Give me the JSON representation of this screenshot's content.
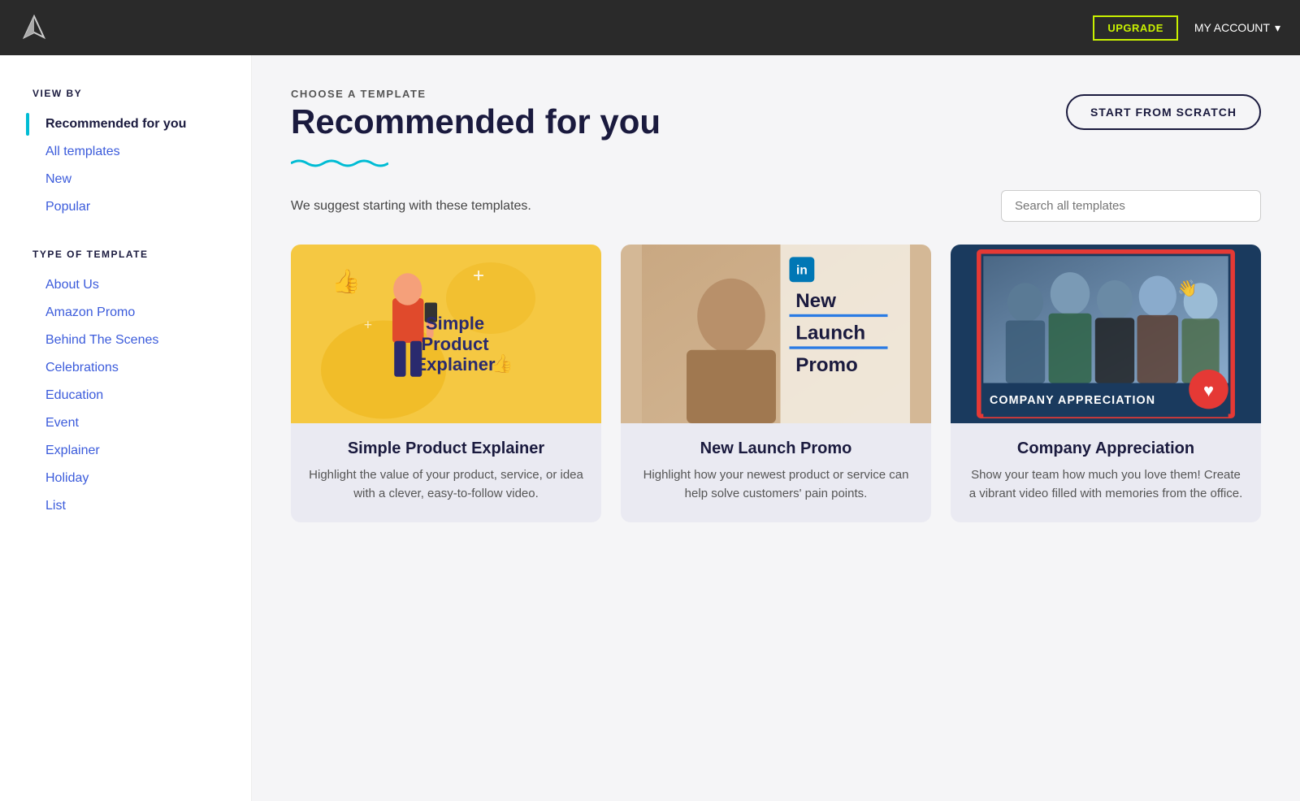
{
  "topnav": {
    "upgrade_label": "UPGRADE",
    "my_account_label": "MY ACCOUNT"
  },
  "sidebar": {
    "view_by_title": "VIEW BY",
    "view_by_items": [
      {
        "label": "Recommended for you",
        "active": true
      },
      {
        "label": "All templates",
        "active": false
      },
      {
        "label": "New",
        "active": false
      },
      {
        "label": "Popular",
        "active": false
      }
    ],
    "type_title": "TYPE OF TEMPLATE",
    "type_items": [
      {
        "label": "About Us"
      },
      {
        "label": "Amazon Promo"
      },
      {
        "label": "Behind The Scenes"
      },
      {
        "label": "Celebrations"
      },
      {
        "label": "Education"
      },
      {
        "label": "Event"
      },
      {
        "label": "Explainer"
      },
      {
        "label": "Holiday"
      },
      {
        "label": "List"
      }
    ]
  },
  "content": {
    "choose_label": "CHOOSE A TEMPLATE",
    "page_title": "Recommended for you",
    "start_scratch_label": "START FROM SCRATCH",
    "subtitle": "We suggest starting with these templates.",
    "search_placeholder": "Search all templates",
    "cards": [
      {
        "title": "Simple Product Explainer",
        "description": "Highlight the value of your product, service, or idea with a clever, easy-to-follow video.",
        "thumb_type": "product_explainer"
      },
      {
        "title": "New Launch Promo",
        "description": "Highlight how your newest product or service can help solve customers' pain points.",
        "thumb_type": "new_launch"
      },
      {
        "title": "Company Appreciation",
        "description": "Show your team how much you love them! Create a vibrant video filled with memories from the office.",
        "thumb_type": "company_appreciation"
      }
    ]
  }
}
